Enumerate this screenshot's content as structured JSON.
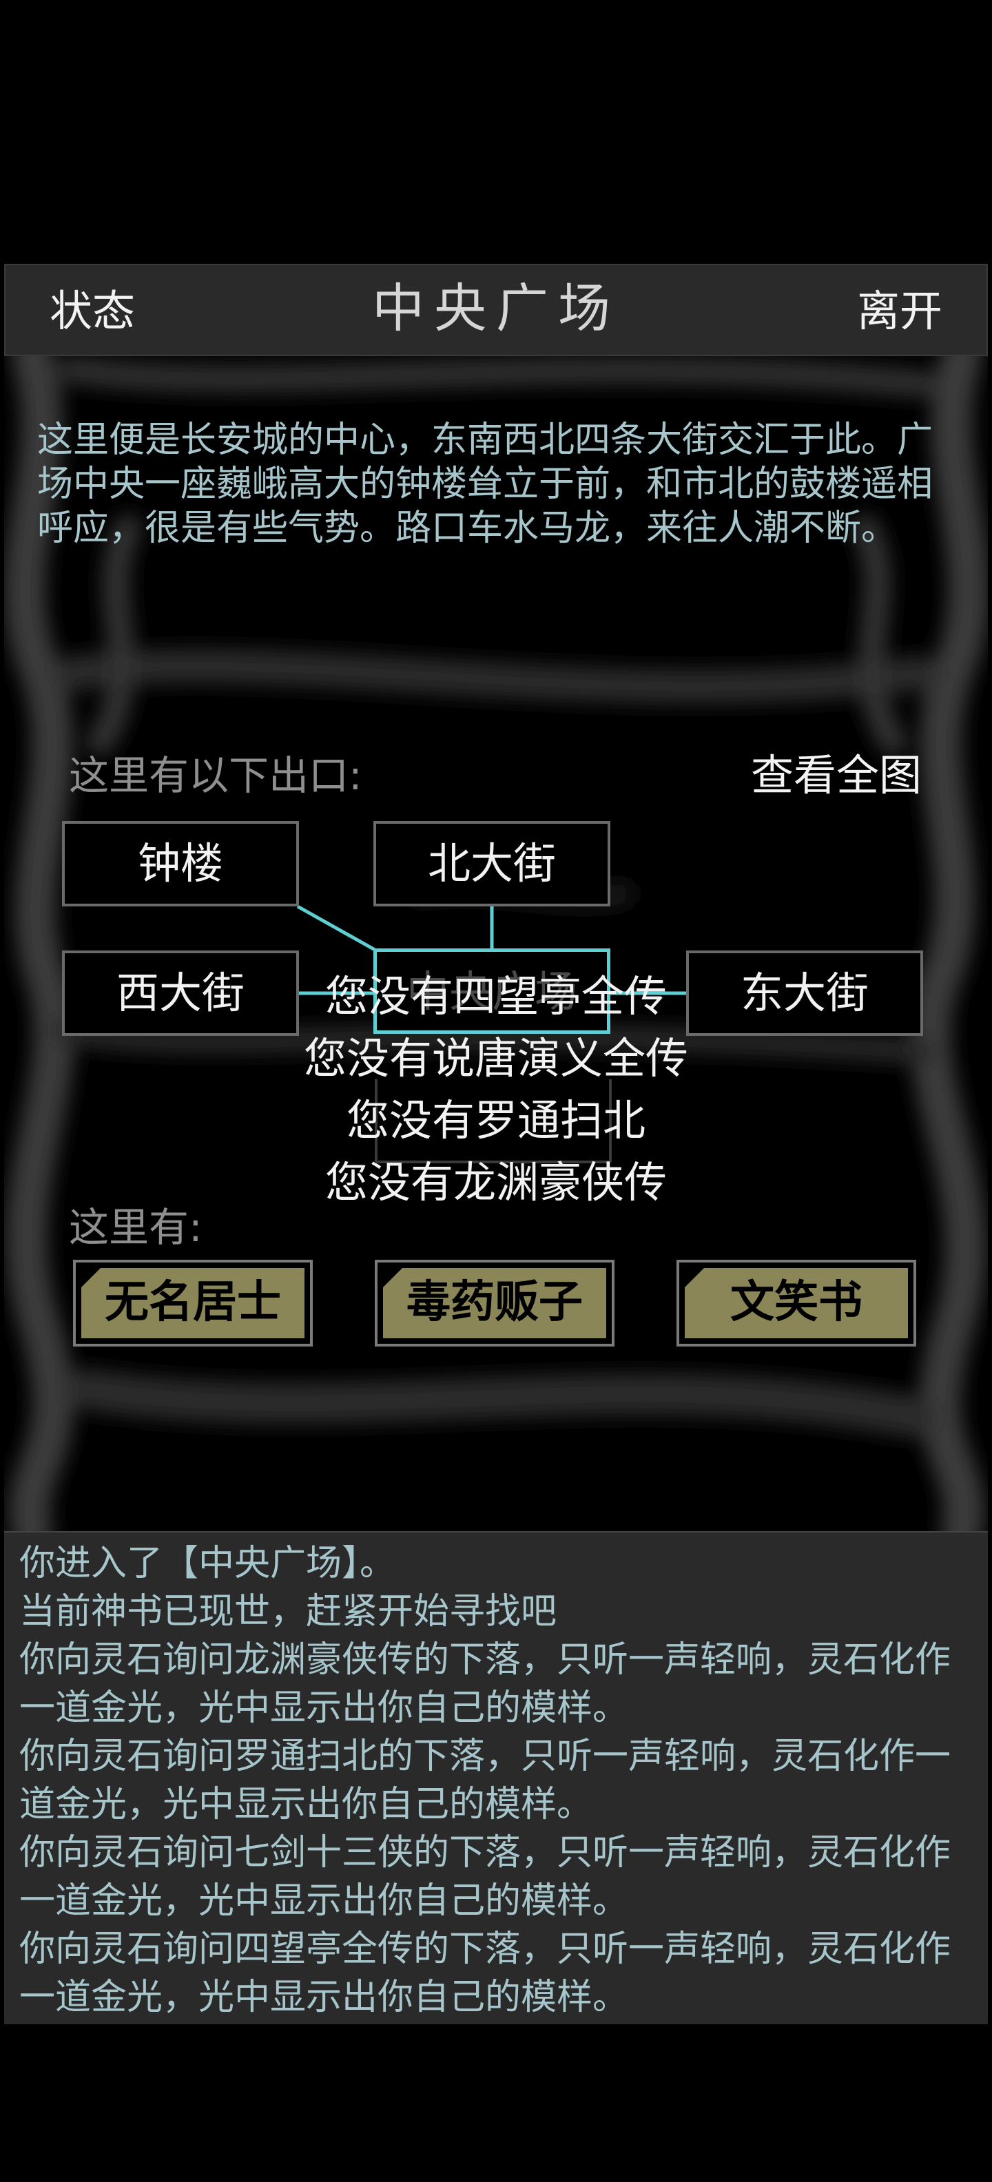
{
  "header": {
    "status_label": "状态",
    "title": "中央广场",
    "leave_label": "离开"
  },
  "description": "这里便是长安城的中心，东南西北四条大街交汇于此。广场中央一座巍峨高大的钟楼耸立于前，和市北的鼓楼遥相呼应，很是有些气势。路口车水马龙，来往人潮不断。",
  "exits": {
    "label": "这里有以下出口:",
    "view_map_label": "查看全图",
    "rooms": {
      "bell_tower": "钟楼",
      "north_street": "北大街",
      "west_street": "西大街",
      "current": "中央广场",
      "east_street": "东大街"
    },
    "line_color": "#5ecfd3"
  },
  "overlay_messages": [
    "您没有四望亭全传",
    "您没有说唐演义全传",
    "您没有罗通扫北",
    "您没有龙渊豪侠传"
  ],
  "npcs": {
    "label": "这里有:",
    "items": [
      "无名居士",
      "毒药贩子",
      "文笑书"
    ],
    "button_color": "#8a8658"
  },
  "log": [
    "你进入了【中央广场】。",
    "当前神书已现世，赶紧开始寻找吧",
    "你向灵石询问龙渊豪侠传的下落，只听一声轻响，灵石化作一道金光，光中显示出你自己的模样。",
    "你向灵石询问罗通扫北的下落，只听一声轻响，灵石化作一道金光，光中显示出你自己的模样。",
    "你向灵石询问七剑十三侠的下落，只听一声轻响，灵石化作一道金光，光中显示出你自己的模样。",
    "你向灵石询问四望亭全传的下落，只听一声轻响，灵石化作一道金光，光中显示出你自己的模样。"
  ]
}
